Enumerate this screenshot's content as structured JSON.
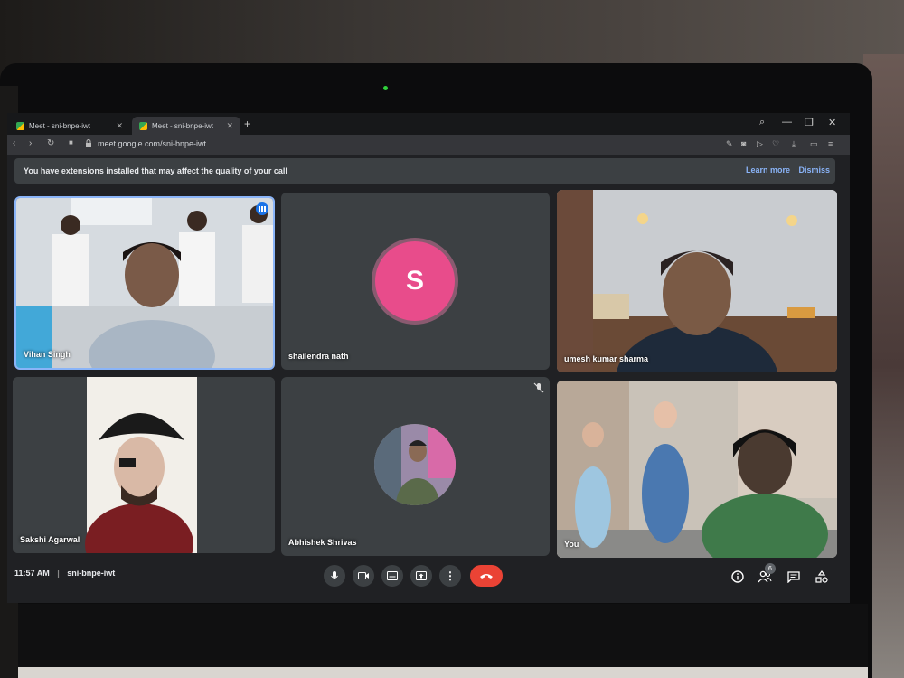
{
  "browser": {
    "tabs": [
      {
        "label": "Meet - sni-bnpe-iwt",
        "active": false
      },
      {
        "label": "Meet - sni-bnpe-iwt",
        "active": true
      }
    ],
    "url": "meet.google.com/sni-bnpe-iwt"
  },
  "notice": {
    "text": "You have extensions installed that may affect the quality of your call",
    "learn_more": "Learn more",
    "dismiss": "Dismiss"
  },
  "participants": [
    {
      "name": "Vihan Singh",
      "speaking": true
    },
    {
      "name": "shailendra nath",
      "avatar_letter": "S",
      "avatar_color": "#e84c8b"
    },
    {
      "name": "umesh kumar sharma"
    },
    {
      "name": "Sakshi Agarwal"
    },
    {
      "name": "Abhishek Shrivas",
      "muted": true
    },
    {
      "name": "You"
    }
  ],
  "bottom_bar": {
    "time": "11:57 AM",
    "separator": "|",
    "meeting_code": "sni-bnpe-iwt",
    "people_count": "6"
  },
  "colors": {
    "accent": "#8ab4f8",
    "hangup": "#ea4335",
    "tile": "#3c4043"
  }
}
